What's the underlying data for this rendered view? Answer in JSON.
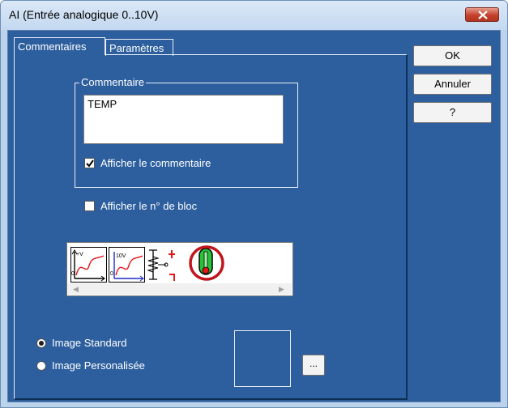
{
  "window": {
    "title": "AI (Entrée analogique 0..10V)"
  },
  "tabs": [
    {
      "label": "Commentaires",
      "active": true
    },
    {
      "label": "Paramètres",
      "active": false
    }
  ],
  "buttons": {
    "ok": "OK",
    "cancel": "Annuler",
    "help": "?"
  },
  "comment_group": {
    "legend": "Commentaire",
    "value": "TEMP",
    "show_comment": {
      "label": "Afficher le commentaire",
      "checked": true
    }
  },
  "show_block_number": {
    "label": "Afficher le n° de bloc",
    "checked": false
  },
  "image_gallery": {
    "items": [
      "graph-0-v-icon",
      "graph-0-10v-icon",
      "resistor-sensor-icon",
      "thermometer-icon"
    ],
    "selected": "thermometer-icon",
    "highlight_color": "#c0151c"
  },
  "image_options": {
    "standard": {
      "label": "Image Standard",
      "selected": true
    },
    "custom": {
      "label": "Image Personalisée",
      "selected": false
    }
  },
  "browse_button": "...",
  "colors": {
    "panel": "#2d5f9e",
    "title_bar": "#cfe0f4",
    "close_button": "#c5412c"
  }
}
